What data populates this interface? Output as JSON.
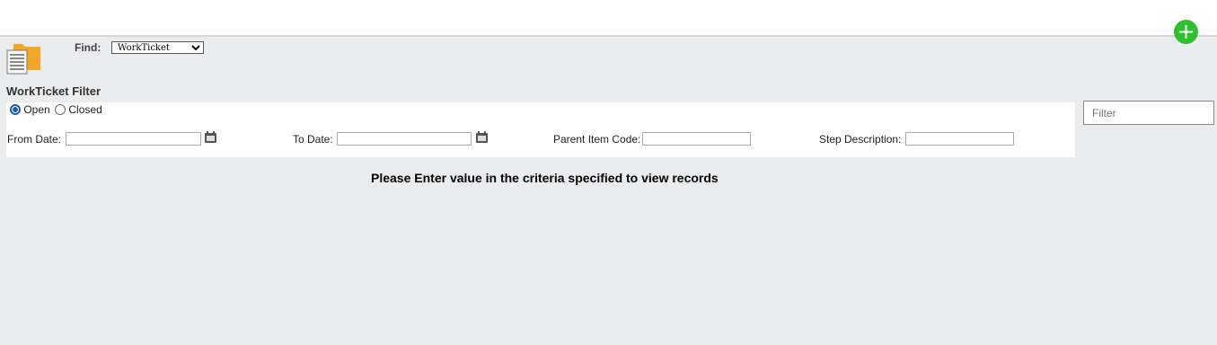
{
  "header": {
    "add_icon": "plus-icon"
  },
  "toolbar": {
    "find_label": "Find:",
    "find_value": "WorkTicket",
    "find_options": [
      "WorkTicket"
    ]
  },
  "filter": {
    "title": "WorkTicket Filter",
    "status": {
      "open_label": "Open",
      "closed_label": "Closed",
      "selected": "Open"
    },
    "from_date_label": "From Date:",
    "from_date_value": "",
    "to_date_label": "To Date:",
    "to_date_value": "",
    "parent_item_label": "Parent Item Code:",
    "parent_item_value": "",
    "step_desc_label": "Step Description:",
    "step_desc_value": "",
    "search_placeholder": "Filter",
    "calendar_icon": "calendar-icon"
  },
  "main": {
    "message": "Please Enter value in the criteria specified to view records"
  },
  "colors": {
    "add_button": "#2ec02e",
    "folder": "#f5a623",
    "background": "#ebecee",
    "radio_selected": "#1a5fb4"
  }
}
